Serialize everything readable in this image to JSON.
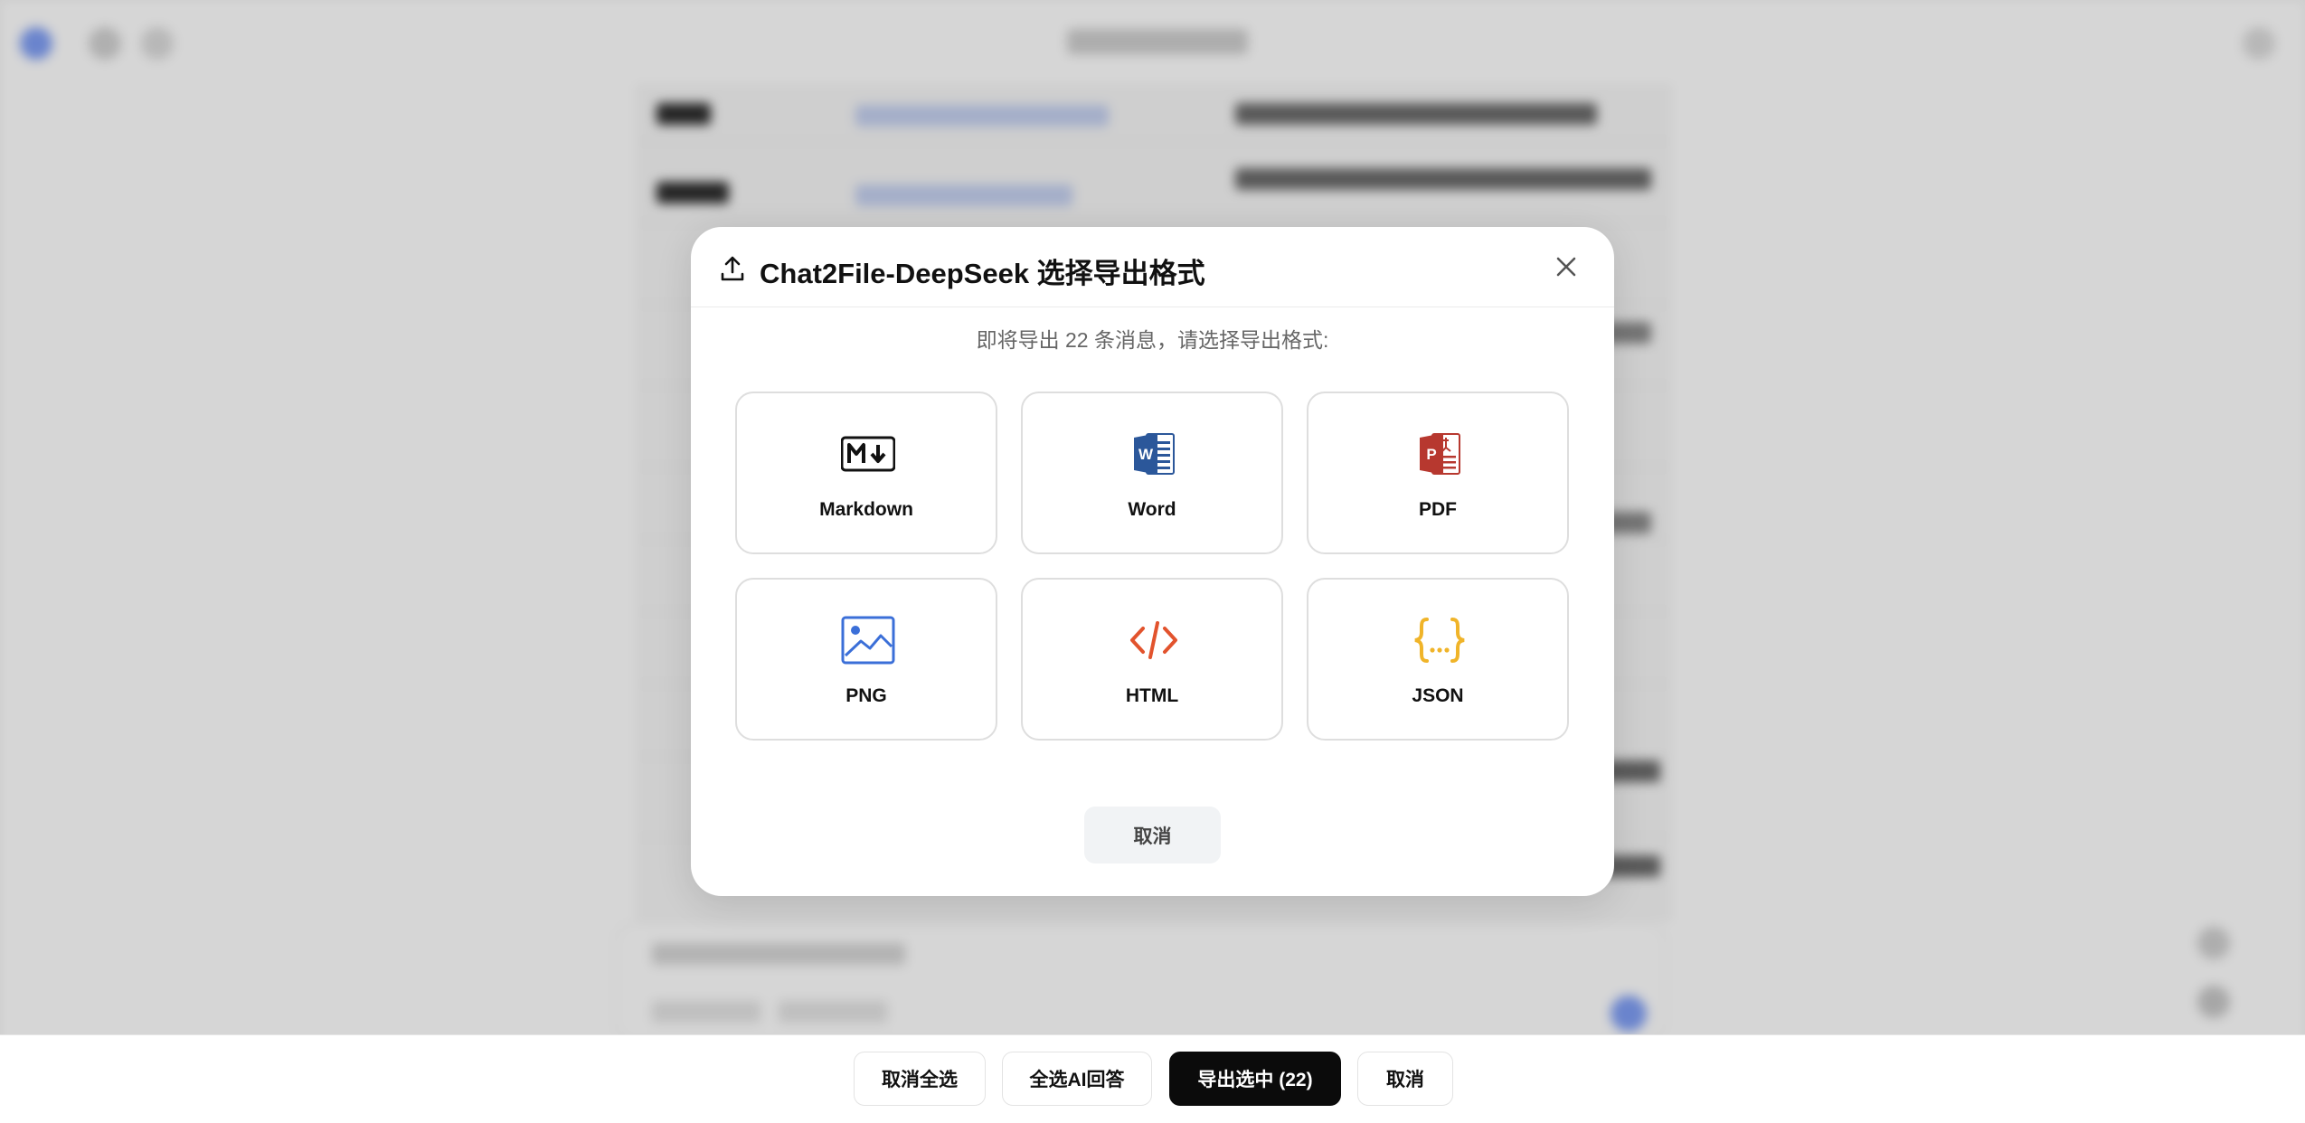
{
  "modal": {
    "title": "Chat2File-DeepSeek 选择导出格式",
    "subtitle": "即将导出 22 条消息，请选择导出格式:",
    "formats": [
      {
        "label": "Markdown",
        "icon": "markdown-icon"
      },
      {
        "label": "Word",
        "icon": "word-icon"
      },
      {
        "label": "PDF",
        "icon": "pdf-icon"
      },
      {
        "label": "PNG",
        "icon": "image-icon"
      },
      {
        "label": "HTML",
        "icon": "code-icon"
      },
      {
        "label": "JSON",
        "icon": "json-icon"
      }
    ],
    "cancel_label": "取消"
  },
  "bottom_bar": {
    "deselect_all_label": "取消全选",
    "select_ai_label": "全选AI回答",
    "export_selected_label": "导出选中 (22)",
    "cancel_label": "取消"
  },
  "colors": {
    "word_blue": "#2b579a",
    "pdf_red": "#b7382f",
    "png_blue": "#3b6fd8",
    "html_orange": "#e2532d",
    "json_yellow": "#f0b429",
    "primary_button": "#0b0b0b"
  }
}
